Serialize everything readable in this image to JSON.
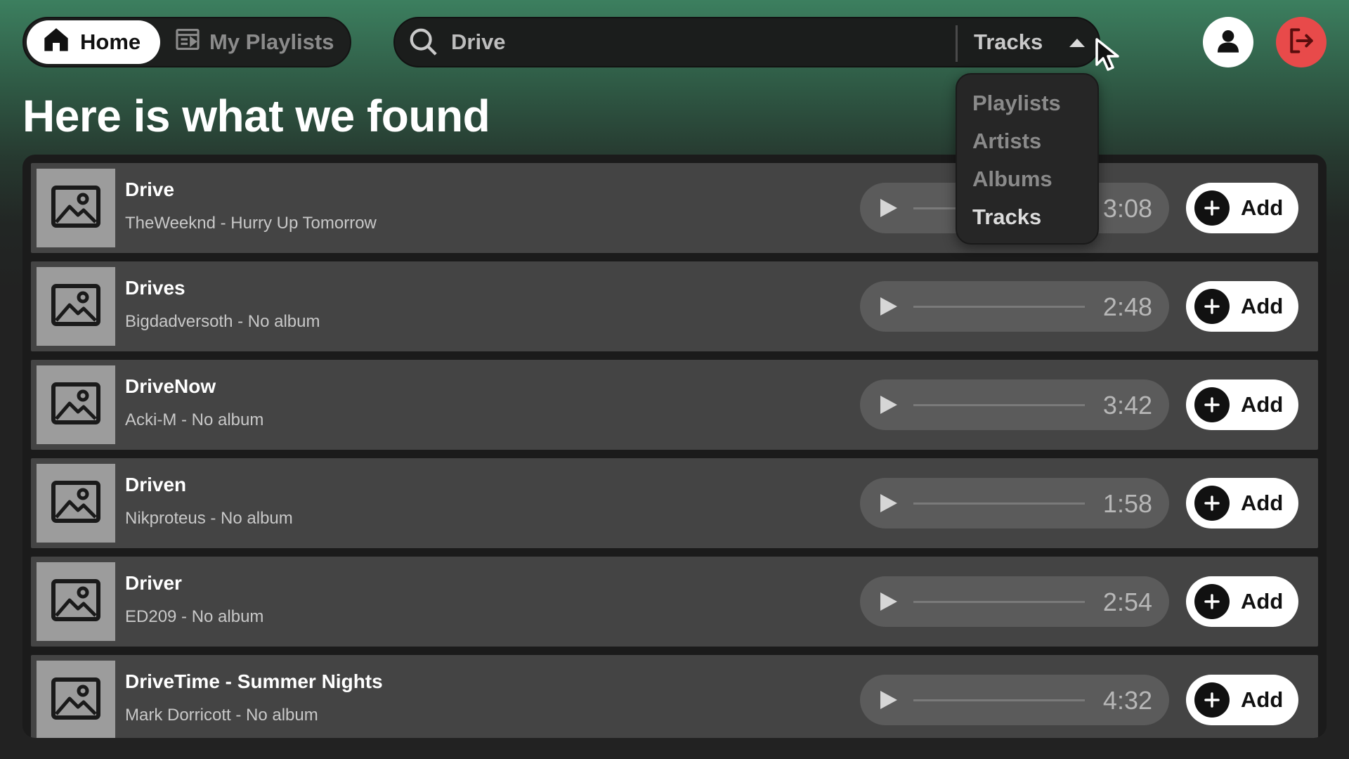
{
  "nav": {
    "home_label": "Home",
    "playlists_label": "My Playlists"
  },
  "search": {
    "value": "Drive",
    "type_selected": "Tracks",
    "type_options": [
      "Playlists",
      "Artists",
      "Albums",
      "Tracks"
    ]
  },
  "heading": "Here is what we found",
  "colors": {
    "accent_green": "#3c7f5f",
    "logout_red": "#e84a4a",
    "row_bg": "#444444"
  },
  "results": [
    {
      "title": "Drive",
      "subtitle": "TheWeeknd - Hurry Up Tomorrow",
      "duration": "3:08",
      "add_label": "Add"
    },
    {
      "title": "Drives",
      "subtitle": "Bigdadversoth - No album",
      "duration": "2:48",
      "add_label": "Add"
    },
    {
      "title": "DriveNow",
      "subtitle": "Acki-M - No album",
      "duration": "3:42",
      "add_label": "Add"
    },
    {
      "title": "Driven",
      "subtitle": "Nikproteus - No album",
      "duration": "1:58",
      "add_label": "Add"
    },
    {
      "title": "Driver",
      "subtitle": "ED209 - No album",
      "duration": "2:54",
      "add_label": "Add"
    },
    {
      "title": "DriveTime - Summer Nights",
      "subtitle": "Mark Dorricott - No album",
      "duration": "4:32",
      "add_label": "Add"
    }
  ]
}
